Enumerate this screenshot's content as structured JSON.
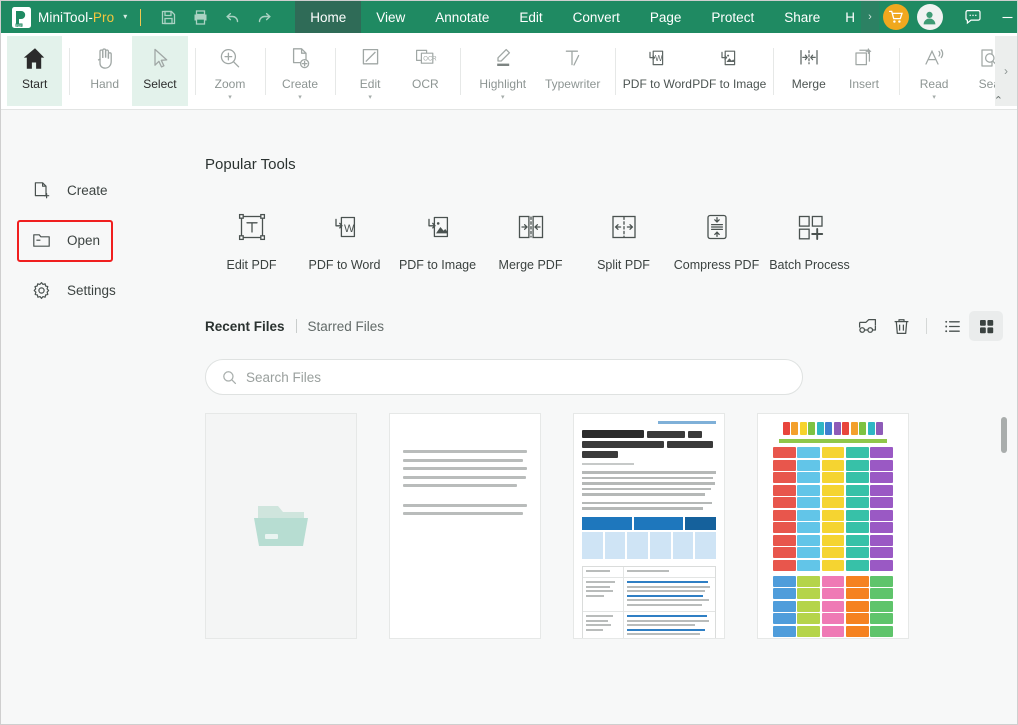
{
  "titlebar": {
    "brand_main": "MiniTool-",
    "brand_pro": "Pro",
    "brand_caret": "▾",
    "quick_access": [
      {
        "name": "save-icon",
        "label": "Save"
      },
      {
        "name": "print-icon",
        "label": "Print"
      },
      {
        "name": "undo-icon",
        "label": "Undo"
      },
      {
        "name": "redo-icon",
        "label": "Redo"
      }
    ],
    "tabs": [
      {
        "label": "Home",
        "active": true
      },
      {
        "label": "View",
        "active": false
      },
      {
        "label": "Annotate",
        "active": false
      },
      {
        "label": "Edit",
        "active": false
      },
      {
        "label": "Convert",
        "active": false
      },
      {
        "label": "Page",
        "active": false
      },
      {
        "label": "Protect",
        "active": false
      },
      {
        "label": "Share",
        "active": false
      },
      {
        "label": "H",
        "active": false
      }
    ],
    "tab_scroll_label": "›",
    "window_controls": {
      "minimize": "–",
      "maximize": "☐",
      "close": "✕"
    },
    "green": "#1f8a62",
    "active_tab_green": "#2f6b57",
    "cart_color": "#f0a81e"
  },
  "ribbon": {
    "items": [
      {
        "label": "Start",
        "icon": "home-icon",
        "active": true,
        "caret": false
      },
      {
        "label": "Hand",
        "icon": "hand-icon",
        "active": false,
        "caret": false
      },
      {
        "label": "Select",
        "icon": "cursor-icon",
        "active": true,
        "caret": false
      },
      {
        "label": "Zoom",
        "icon": "zoom-in-icon",
        "active": false,
        "caret": true
      },
      {
        "label": "Create",
        "icon": "create-file-icon",
        "active": false,
        "caret": true
      },
      {
        "label": "Edit",
        "icon": "edit-page-icon",
        "active": false,
        "caret": true
      },
      {
        "label": "OCR",
        "icon": "ocr-icon",
        "active": false,
        "caret": false
      },
      {
        "label": "Highlight",
        "icon": "highlighter-icon",
        "active": false,
        "caret": true
      },
      {
        "label": "Typewriter",
        "icon": "typewriter-icon",
        "active": false,
        "caret": false
      },
      {
        "label": "PDF to Word",
        "icon": "pdf-to-word-icon",
        "active": false,
        "caret": false
      },
      {
        "label": "PDF to Image",
        "icon": "pdf-to-image-icon",
        "active": false,
        "caret": false
      },
      {
        "label": "Merge",
        "icon": "merge-icon",
        "active": false,
        "caret": false
      },
      {
        "label": "Insert",
        "icon": "insert-page-icon",
        "active": false,
        "caret": false
      },
      {
        "label": "Read",
        "icon": "read-aloud-icon",
        "active": false,
        "caret": true
      },
      {
        "label": "Sea",
        "icon": "search-doc-icon",
        "active": false,
        "caret": false
      }
    ],
    "overflow_label": "›",
    "collapse_label": "⌃"
  },
  "sidebar": {
    "items": [
      {
        "label": "Create",
        "icon": "new-file-icon",
        "annotated": false
      },
      {
        "label": "Open",
        "icon": "folder-icon",
        "annotated": true
      },
      {
        "label": "Settings",
        "icon": "gear-icon",
        "annotated": false
      }
    ],
    "annotation_color": "#f01f1f"
  },
  "main": {
    "popular_tools_title": "Popular Tools",
    "tools": [
      {
        "label": "Edit PDF",
        "icon": "text-box-icon"
      },
      {
        "label": "PDF to Word",
        "icon": "pdf-to-word-icon"
      },
      {
        "label": "PDF to Image",
        "icon": "pdf-to-image-icon"
      },
      {
        "label": "Merge PDF",
        "icon": "merge-arrows-icon"
      },
      {
        "label": "Split PDF",
        "icon": "split-arrows-icon"
      },
      {
        "label": "Compress PDF",
        "icon": "compress-icon"
      },
      {
        "label": "Batch Process",
        "icon": "batch-grid-icon"
      }
    ],
    "recent_tabs": [
      {
        "label": "Recent Files",
        "active": true
      },
      {
        "label": "Starred Files",
        "active": false
      }
    ],
    "actions": [
      {
        "name": "read-mode-icon",
        "label": "Read Mode",
        "selected": false
      },
      {
        "name": "delete-icon",
        "label": "Delete",
        "selected": false
      },
      {
        "name": "list-view-icon",
        "label": "List View",
        "selected": false
      },
      {
        "name": "grid-view-icon",
        "label": "Grid View",
        "selected": true
      }
    ],
    "search": {
      "placeholder": "Search Files",
      "value": "",
      "icon": "search-icon"
    },
    "files": [
      {
        "type": "placeholder",
        "name": "open-file-placeholder",
        "icon": "folder-icon"
      },
      {
        "type": "text-document",
        "name": "document-thumbnail"
      },
      {
        "type": "web-article",
        "name": "document-thumbnail"
      },
      {
        "type": "sight-words-poster",
        "name": "document-thumbnail"
      }
    ]
  }
}
